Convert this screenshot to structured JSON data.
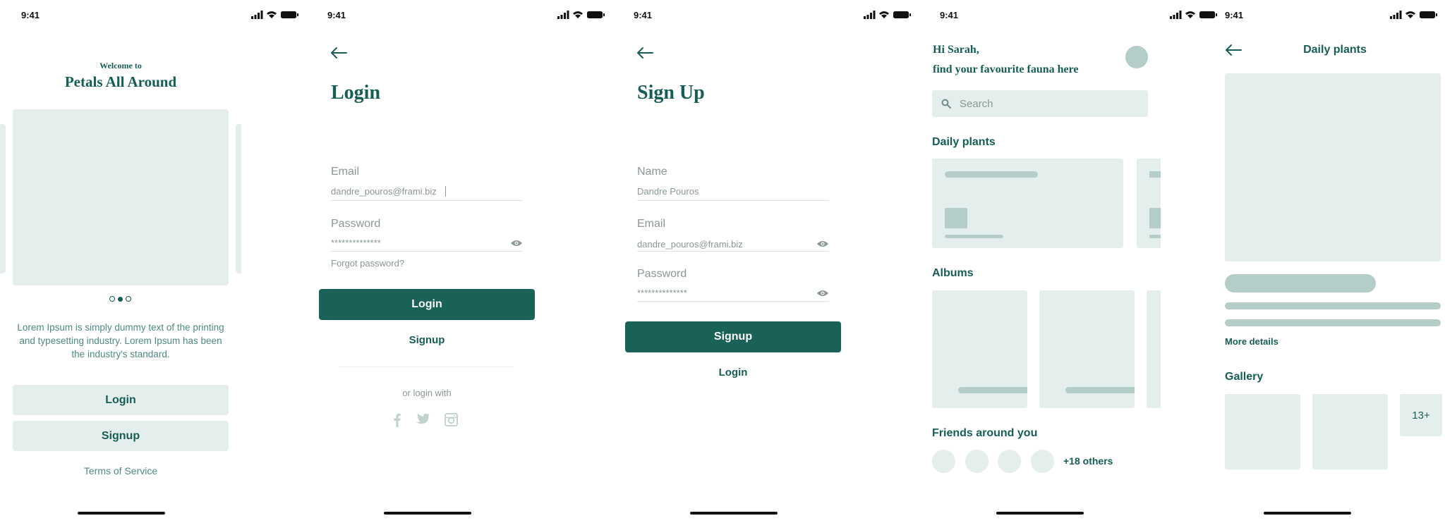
{
  "status": {
    "time": "9:41"
  },
  "welcome": {
    "subtitle": "Welcome to",
    "title": "Petals All Around",
    "description": "Lorem Ipsum is simply dummy text of the printing and typesetting industry. Lorem Ipsum has been the industry's standard.",
    "login_label": "Login",
    "signup_label": "Signup",
    "terms_label": "Terms of Service",
    "carousel": {
      "pages": 3,
      "active": 2
    }
  },
  "login": {
    "title": "Login",
    "email_label": "Email",
    "email_value": "dandre_pouros@frami.biz",
    "password_label": "Password",
    "password_value": "**************",
    "forgot_label": "Forgot password?",
    "login_button": "Login",
    "signup_link": "Signup",
    "or_login_with": "or login with",
    "social": [
      "facebook-icon",
      "twitter-icon",
      "instagram-icon"
    ]
  },
  "signup": {
    "title": "Sign Up",
    "name_label": "Name",
    "name_value": "Dandre Pouros",
    "email_label": "Email",
    "email_value": "dandre_pouros@frami.biz",
    "password_label": "Password",
    "password_value": "**************",
    "signup_button": "Signup",
    "login_link": "Login"
  },
  "home": {
    "greeting_line1": "Hi Sarah,",
    "greeting_line2": "find your favourite fauna here",
    "search_placeholder": "Search",
    "daily_plants_title": "Daily plants",
    "albums_title": "Albums",
    "friends_title": "Friends around you",
    "friends_more": "+18 others"
  },
  "detail": {
    "title": "Daily plants",
    "more_details": "More details",
    "gallery_title": "Gallery",
    "gallery_more": "13+"
  },
  "colors": {
    "accent": "#1a6158",
    "placeholder": "#e4eeec",
    "placeholder_dark": "#b4cdc9",
    "text_muted": "#8b9896"
  }
}
